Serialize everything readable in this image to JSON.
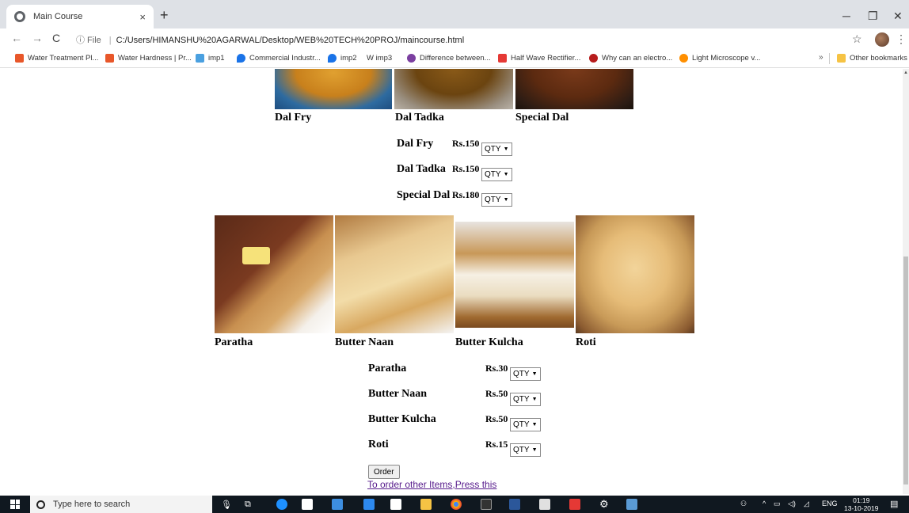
{
  "browser": {
    "tab_title": "Main Course",
    "tab_close": "×",
    "new_tab": "+",
    "url_info": "ⓘ File",
    "url": "C:/Users/HIMANSHU%20AGARWAL/Desktop/WEB%20TECH%20PROJ/maincourse.html",
    "bookmarks": [
      {
        "label": "Water Treatment Pl...",
        "color": "#e8572a"
      },
      {
        "label": "Water Hardness | Pr...",
        "color": "#e8572a"
      },
      {
        "label": "imp1",
        "color": "#4aa0e0"
      },
      {
        "label": "Commercial Industr...",
        "color": "#1a73e8"
      },
      {
        "label": "imp2",
        "color": "#1a73e8"
      },
      {
        "label": "W  imp3",
        "color": "#ffffff"
      },
      {
        "label": "Difference between...",
        "color": "#7b3fa0"
      },
      {
        "label": "Half Wave Rectifier...",
        "color": "#e53935"
      },
      {
        "label": "Why can an electro...",
        "color": "#b71c1c"
      },
      {
        "label": "Light Microscope v...",
        "color": "#ff8f00"
      }
    ],
    "bookmarks_more": "»",
    "other_bookmarks": "Other bookmarks"
  },
  "page": {
    "dal_dishes": [
      "Dal Fry",
      "Dal Tadka",
      "Special Dal"
    ],
    "dal_prices": [
      {
        "name": "Dal Fry",
        "price": "Rs.150",
        "qty": "QTY"
      },
      {
        "name": "Dal Tadka",
        "price": "Rs.150",
        "qty": "QTY"
      },
      {
        "name": "Special Dal",
        "price": "Rs.180",
        "qty": "QTY"
      }
    ],
    "bread_dishes": [
      "Paratha",
      "Butter Naan",
      "Butter Kulcha",
      "Roti"
    ],
    "bread_prices": [
      {
        "name": "Paratha",
        "price": "Rs.30",
        "qty": "QTY"
      },
      {
        "name": "Butter Naan",
        "price": "Rs.50",
        "qty": "QTY"
      },
      {
        "name": "Butter Kulcha",
        "price": "Rs.50",
        "qty": "QTY"
      },
      {
        "name": "Roti",
        "price": "Rs.15",
        "qty": "QTY"
      }
    ],
    "order_button": "Order",
    "other_items_link": "To order other Items,Press this"
  },
  "taskbar": {
    "search_placeholder": "Type here to search",
    "lang": "ENG",
    "time": "01:19",
    "date": "13-10-2019"
  },
  "colors": {
    "tab_strip": "#dee1e6",
    "taskbar": "#101820",
    "visited_link": "#551a8b"
  }
}
